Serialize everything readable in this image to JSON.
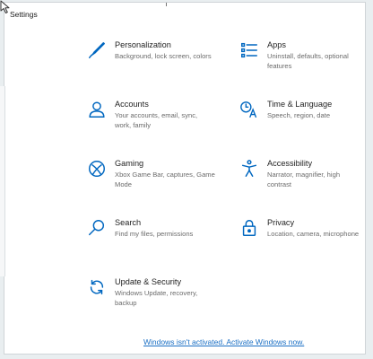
{
  "window": {
    "title": "Settings"
  },
  "colors": {
    "accent": "#0067c0",
    "link": "#1a6fc4"
  },
  "tiles": [
    {
      "icon": "pen-icon",
      "name": "Personalization",
      "desc": "Background, lock screen, colors"
    },
    {
      "icon": "apps-list-icon",
      "name": "Apps",
      "desc": "Uninstall, defaults, optional features"
    },
    {
      "icon": "person-icon",
      "name": "Accounts",
      "desc": "Your accounts, email, sync, work, family"
    },
    {
      "icon": "time-language-icon",
      "name": "Time & Language",
      "desc": "Speech, region, date"
    },
    {
      "icon": "xbox-icon",
      "name": "Gaming",
      "desc": "Xbox Game Bar, captures, Game Mode"
    },
    {
      "icon": "accessibility-icon",
      "name": "Accessibility",
      "desc": "Narrator, magnifier, high contrast"
    },
    {
      "icon": "search-icon",
      "name": "Search",
      "desc": "Find my files, permissions"
    },
    {
      "icon": "lock-icon",
      "name": "Privacy",
      "desc": "Location, camera, microphone"
    },
    {
      "icon": "sync-icon",
      "name": "Update & Security",
      "desc": "Windows Update, recovery, backup"
    }
  ],
  "activation": {
    "link_text": "Windows isn't activated. Activate Windows now."
  }
}
